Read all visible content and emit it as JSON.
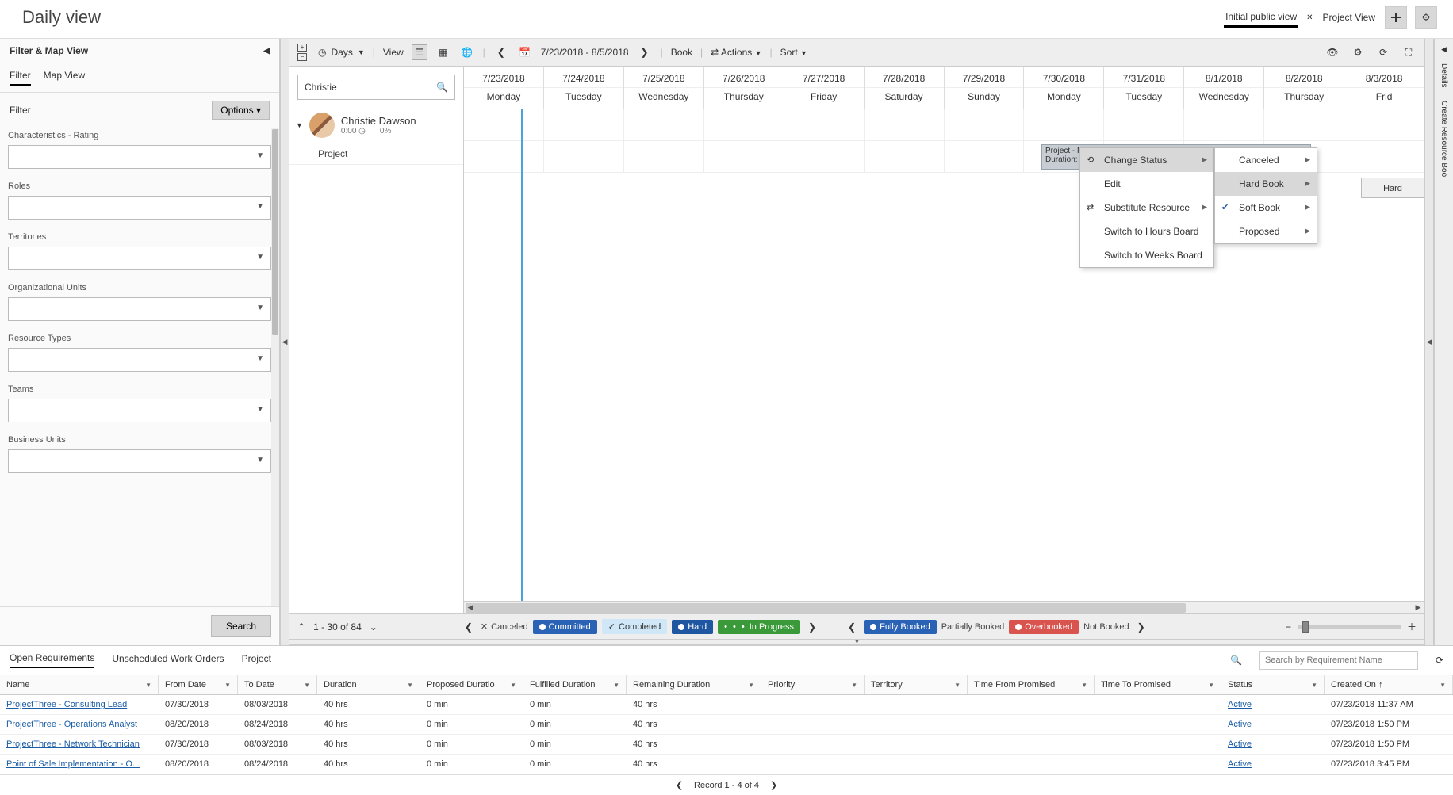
{
  "header": {
    "title": "Daily view",
    "views": {
      "initial": "Initial public view",
      "project": "Project View"
    }
  },
  "sidebar": {
    "title": "Filter & Map View",
    "tabs": {
      "filter": "Filter",
      "map": "Map View"
    },
    "filter_label": "Filter",
    "options": "Options ▾",
    "groups": [
      {
        "label": "Characteristics - Rating"
      },
      {
        "label": "Roles"
      },
      {
        "label": "Territories"
      },
      {
        "label": "Organizational Units"
      },
      {
        "label": "Resource Types"
      },
      {
        "label": "Teams"
      },
      {
        "label": "Business Units"
      }
    ],
    "search": "Search"
  },
  "toolbar": {
    "days": "Days",
    "view": "View",
    "range": "7/23/2018 - 8/5/2018",
    "book": "Book",
    "actions": "Actions",
    "sort": "Sort"
  },
  "schedule": {
    "search_value": "Christie",
    "resource": {
      "name": "Christie Dawson",
      "hours": "0:00",
      "pct": "0%",
      "project": "Project"
    },
    "columns": [
      {
        "date": "7/23/2018",
        "dow": "Monday"
      },
      {
        "date": "7/24/2018",
        "dow": "Tuesday"
      },
      {
        "date": "7/25/2018",
        "dow": "Wednesday"
      },
      {
        "date": "7/26/2018",
        "dow": "Thursday"
      },
      {
        "date": "7/27/2018",
        "dow": "Friday"
      },
      {
        "date": "7/28/2018",
        "dow": "Saturday"
      },
      {
        "date": "7/29/2018",
        "dow": "Sunday"
      },
      {
        "date": "7/30/2018",
        "dow": "Monday"
      },
      {
        "date": "7/31/2018",
        "dow": "Tuesday"
      },
      {
        "date": "8/1/2018",
        "dow": "Wednesday"
      },
      {
        "date": "8/2/2018",
        "dow": "Thursday"
      },
      {
        "date": "8/3/2018",
        "dow": "Frid"
      }
    ],
    "booking": {
      "line1": "Project - Point of Sale Implemen",
      "line2": "Duration:"
    },
    "hard_label": "Hard"
  },
  "context_menu": {
    "items": [
      {
        "label": "Change Status",
        "submenu": true,
        "icon": "refresh"
      },
      {
        "label": "Edit"
      },
      {
        "label": "Substitute Resource",
        "submenu": true,
        "icon": "swap"
      },
      {
        "label": "Switch to Hours Board"
      },
      {
        "label": "Switch to Weeks Board"
      }
    ],
    "submenu": [
      {
        "label": "Canceled",
        "submenu": true
      },
      {
        "label": "Hard Book",
        "submenu": true,
        "hover": true
      },
      {
        "label": "Soft Book",
        "submenu": true,
        "icon": "check"
      },
      {
        "label": "Proposed",
        "submenu": true
      }
    ]
  },
  "board_footer": {
    "page": "1 - 30 of 84",
    "chips": [
      {
        "label": "Canceled",
        "text_only": true,
        "icon": "✕"
      },
      {
        "label": "Committed",
        "color": "#2a63b5"
      },
      {
        "label": "Completed",
        "color": "#cfe7f7",
        "text": "#333",
        "icon": "✓"
      },
      {
        "label": "Hard",
        "color": "#1f56a2"
      },
      {
        "label": "In Progress",
        "color": "#3a9a3a",
        "pre": "• • •"
      },
      {
        "label": "Fully Booked",
        "color": "#2a63b5"
      },
      {
        "label": "Partially Booked",
        "text_only": true
      },
      {
        "label": "Overbooked",
        "color": "#d9534f"
      },
      {
        "label": "Not Booked",
        "text_only": true
      }
    ]
  },
  "bottom": {
    "tabs": {
      "open": "Open Requirements",
      "unsched": "Unscheduled Work Orders",
      "project": "Project"
    },
    "search_placeholder": "Search by Requirement Name",
    "headers": {
      "name": "Name",
      "from": "From Date",
      "to": "To Date",
      "dur": "Duration",
      "pdur": "Proposed Duratio",
      "fdur": "Fulfilled Duration",
      "rdur": "Remaining Duration",
      "pr": "Priority",
      "terr": "Territory",
      "tfp": "Time From Promised",
      "ttp": "Time To Promised",
      "st": "Status",
      "co": "Created On"
    },
    "rows": [
      {
        "name": "ProjectThree - Consulting Lead",
        "from": "07/30/2018",
        "to": "08/03/2018",
        "dur": "40 hrs",
        "pdur": "0 min",
        "fdur": "0 min",
        "rdur": "40 hrs",
        "st": "Active",
        "co": "07/23/2018 11:37 AM"
      },
      {
        "name": "ProjectThree - Operations Analyst",
        "from": "08/20/2018",
        "to": "08/24/2018",
        "dur": "40 hrs",
        "pdur": "0 min",
        "fdur": "0 min",
        "rdur": "40 hrs",
        "st": "Active",
        "co": "07/23/2018 1:50 PM"
      },
      {
        "name": "ProjectThree - Network Technician",
        "from": "07/30/2018",
        "to": "08/03/2018",
        "dur": "40 hrs",
        "pdur": "0 min",
        "fdur": "0 min",
        "rdur": "40 hrs",
        "st": "Active",
        "co": "07/23/2018 1:50 PM"
      },
      {
        "name": "Point of Sale Implementation - O...",
        "from": "08/20/2018",
        "to": "08/24/2018",
        "dur": "40 hrs",
        "pdur": "0 min",
        "fdur": "0 min",
        "rdur": "40 hrs",
        "st": "Active",
        "co": "07/23/2018 3:45 PM"
      }
    ],
    "footer": "Record 1 - 4 of 4"
  },
  "rail": {
    "details": "Details",
    "create": "Create Resource Boo"
  }
}
